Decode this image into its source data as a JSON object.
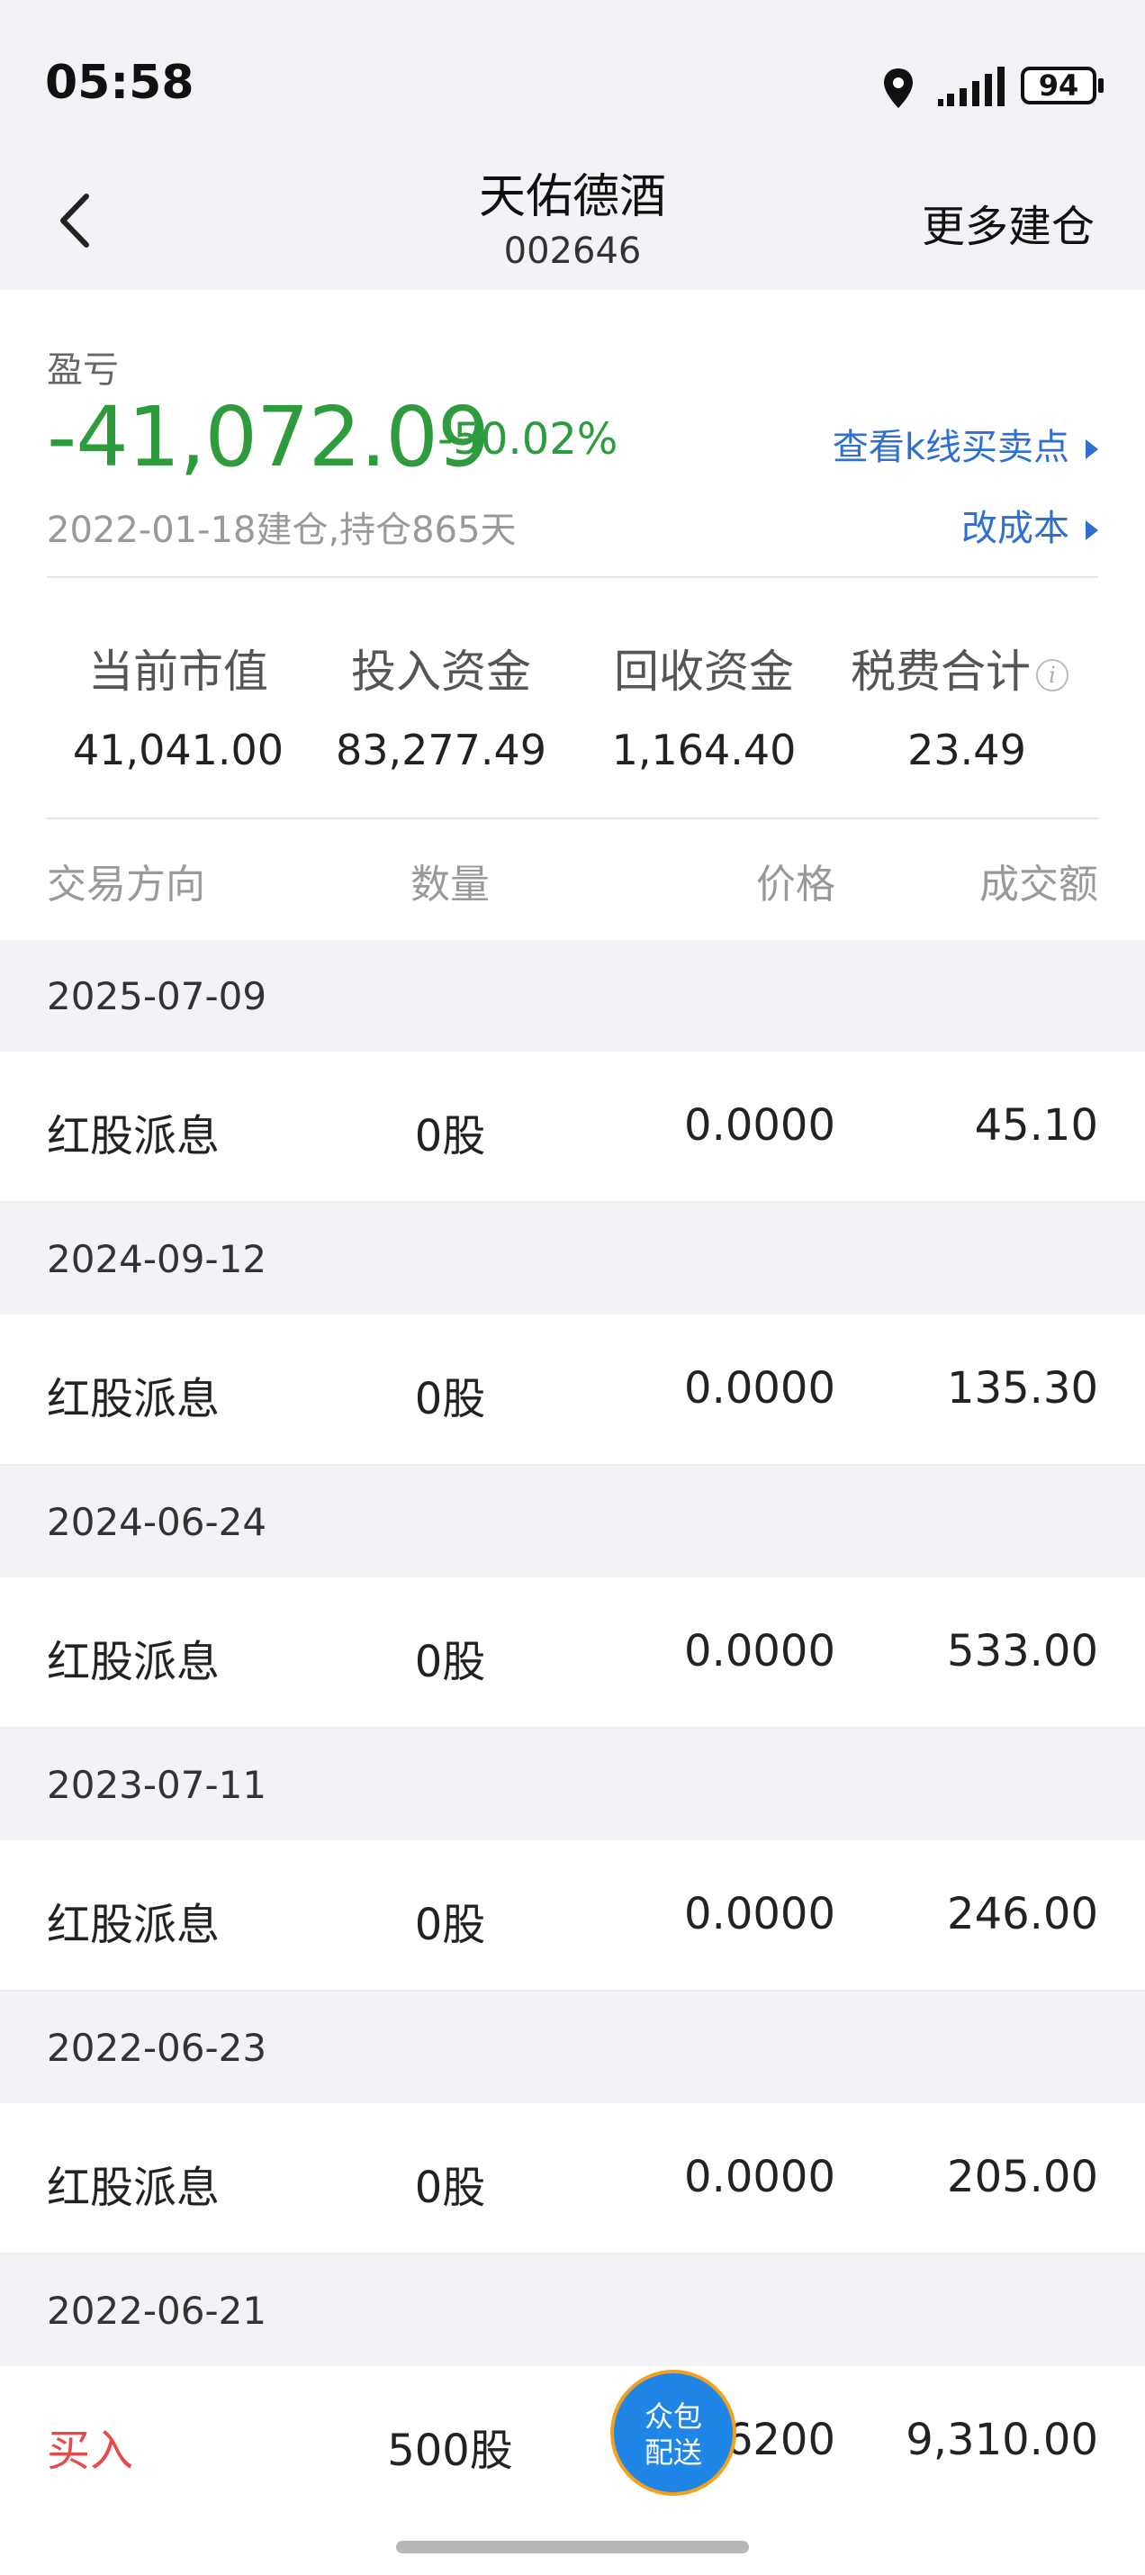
{
  "status_bar": {
    "time": "05:58",
    "battery": "94"
  },
  "nav": {
    "title": "天佑德酒",
    "code": "002646",
    "more": "更多建仓"
  },
  "summary": {
    "pl_label": "盈亏",
    "pl_value": "-41,072.09",
    "pl_pct": "-50.02%",
    "hold_info": "2022-01-18建仓,持仓865天",
    "link_kline": "查看k线买卖点",
    "link_cost": "改成本",
    "stats": [
      {
        "label": "当前市值",
        "value": "41,041.00"
      },
      {
        "label": "投入资金",
        "value": "83,277.49"
      },
      {
        "label": "回收资金",
        "value": "1,164.40"
      },
      {
        "label": "税费合计",
        "value": "23.49"
      }
    ],
    "info_icon": "i"
  },
  "table": {
    "headers": {
      "direction": "交易方向",
      "qty": "数量",
      "price": "价格",
      "amount": "成交额"
    },
    "groups": [
      {
        "date": "2025-07-09",
        "type": "红股派息",
        "qty": "0股",
        "price": "0.0000",
        "amount": "45.10"
      },
      {
        "date": "2024-09-12",
        "type": "红股派息",
        "qty": "0股",
        "price": "0.0000",
        "amount": "135.30"
      },
      {
        "date": "2024-06-24",
        "type": "红股派息",
        "qty": "0股",
        "price": "0.0000",
        "amount": "533.00"
      },
      {
        "date": "2023-07-11",
        "type": "红股派息",
        "qty": "0股",
        "price": "0.0000",
        "amount": "246.00"
      },
      {
        "date": "2022-06-23",
        "type": "红股派息",
        "qty": "0股",
        "price": "0.0000",
        "amount": "205.00"
      },
      {
        "date": "2022-06-21",
        "type": "买入",
        "qty": "500股",
        "price": "6200",
        "amount": "9,310.00"
      }
    ]
  },
  "fab": {
    "line1": "众包",
    "line2": "配送"
  },
  "colors": {
    "loss": "#2e9b3d",
    "link": "#2f6fd1",
    "buy": "#e84a4a"
  }
}
